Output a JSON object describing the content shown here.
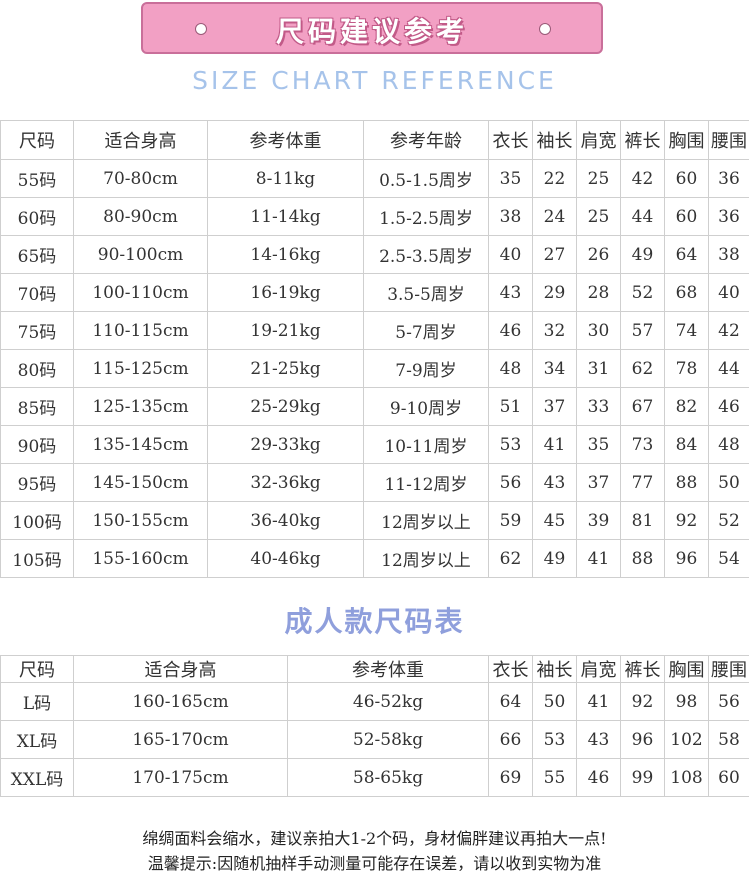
{
  "banner": {
    "title": "尺码建议参考"
  },
  "subtitle": "SIZE CHART REFERENCE",
  "kids_table": {
    "headers": [
      "尺码",
      "适合身高",
      "参考体重",
      "参考年龄",
      "衣长",
      "袖长",
      "肩宽",
      "裤长",
      "胸围",
      "腰围"
    ],
    "rows": [
      [
        "55码",
        "70-80cm",
        "8-11kg",
        "0.5-1.5周岁",
        "35",
        "22",
        "25",
        "42",
        "60",
        "36"
      ],
      [
        "60码",
        "80-90cm",
        "11-14kg",
        "1.5-2.5周岁",
        "38",
        "24",
        "25",
        "44",
        "60",
        "36"
      ],
      [
        "65码",
        "90-100cm",
        "14-16kg",
        "2.5-3.5周岁",
        "40",
        "27",
        "26",
        "49",
        "64",
        "38"
      ],
      [
        "70码",
        "100-110cm",
        "16-19kg",
        "3.5-5周岁",
        "43",
        "29",
        "28",
        "52",
        "68",
        "40"
      ],
      [
        "75码",
        "110-115cm",
        "19-21kg",
        "5-7周岁",
        "46",
        "32",
        "30",
        "57",
        "74",
        "42"
      ],
      [
        "80码",
        "115-125cm",
        "21-25kg",
        "7-9周岁",
        "48",
        "34",
        "31",
        "62",
        "78",
        "44"
      ],
      [
        "85码",
        "125-135cm",
        "25-29kg",
        "9-10周岁",
        "51",
        "37",
        "33",
        "67",
        "82",
        "46"
      ],
      [
        "90码",
        "135-145cm",
        "29-33kg",
        "10-11周岁",
        "53",
        "41",
        "35",
        "73",
        "84",
        "48"
      ],
      [
        "95码",
        "145-150cm",
        "32-36kg",
        "11-12周岁",
        "56",
        "43",
        "37",
        "77",
        "88",
        "50"
      ],
      [
        "100码",
        "150-155cm",
        "36-40kg",
        "12周岁以上",
        "59",
        "45",
        "39",
        "81",
        "92",
        "52"
      ],
      [
        "105码",
        "155-160cm",
        "40-46kg",
        "12周岁以上",
        "62",
        "49",
        "41",
        "88",
        "96",
        "54"
      ]
    ]
  },
  "adult_title": "成人款尺码表",
  "adult_table": {
    "headers": [
      "尺码",
      "适合身高",
      "参考体重",
      "衣长",
      "袖长",
      "肩宽",
      "裤长",
      "胸围",
      "腰围"
    ],
    "rows": [
      [
        "L码",
        "160-165cm",
        "46-52kg",
        "64",
        "50",
        "41",
        "92",
        "98",
        "56"
      ],
      [
        "XL码",
        "165-170cm",
        "52-58kg",
        "66",
        "53",
        "43",
        "96",
        "102",
        "58"
      ],
      [
        "XXL码",
        "170-175cm",
        "58-65kg",
        "69",
        "55",
        "46",
        "99",
        "108",
        "60"
      ]
    ]
  },
  "notes": [
    "绵绸面料会缩水，建议亲拍大1-2个码，身材偏胖建议再拍大一点!",
    "温馨提示:因随机抽样手动测量可能存在误差，请以收到实物为准"
  ]
}
